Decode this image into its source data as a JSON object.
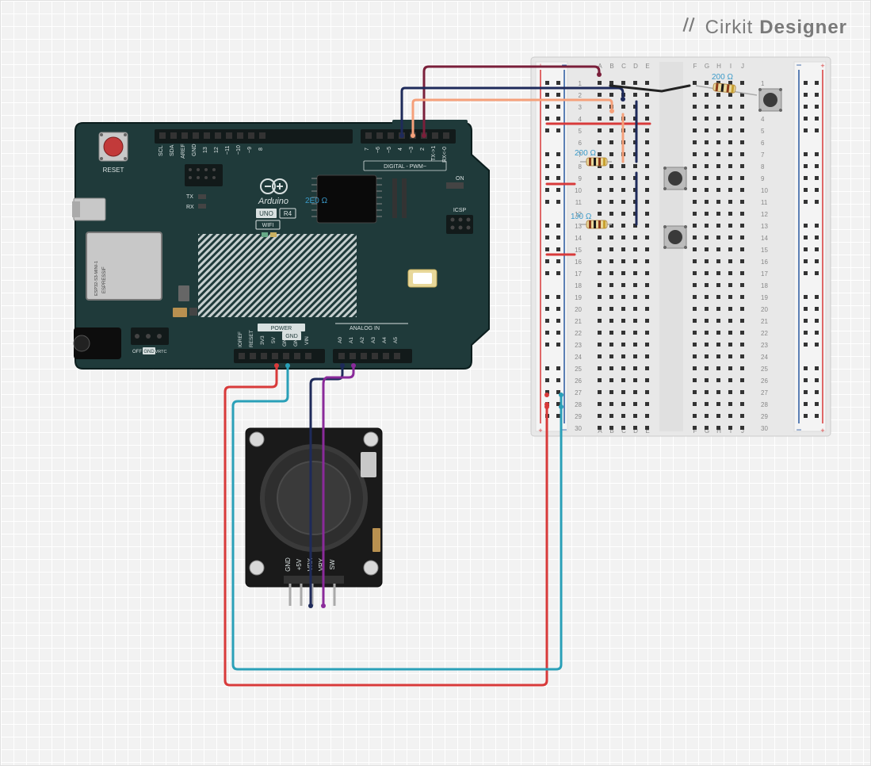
{
  "logo": {
    "brand1": "Cirkit",
    "brand2": "Designer"
  },
  "arduino": {
    "board_line1": "UNO",
    "board_line2": "R4",
    "board_line3": "WIFI",
    "espressif": "ESPRESSIF",
    "esp32_label": "ESP32-S3-MINI-1",
    "reset": "RESET",
    "digital_header": "DIGITAL - PWM~",
    "analog_header": "ANALOG  IN",
    "power_header": "POWER",
    "icsp": "ICSP",
    "tx": "TX",
    "rx": "RX",
    "on": "ON",
    "off": "OFF",
    "gnd_barrel": "GND",
    "vrtc": "VRTC",
    "pins_top": [
      "SCL",
      "SDA",
      "AREF",
      "GND",
      "13",
      "12",
      "~11",
      "~10",
      "~9",
      "8",
      "7",
      "~6",
      "~5",
      "4",
      "~3",
      "2",
      "TX->1",
      "RX<-0"
    ],
    "pins_bottom": [
      "IOREF",
      "RESET",
      "3V3",
      "5V",
      "GND",
      "GND",
      "VIN",
      "A0",
      "A1",
      "A2",
      "A3",
      "A4",
      "A5"
    ]
  },
  "joystick": {
    "pins": [
      "GND",
      "+5V",
      "VRX",
      "VRY",
      "SW"
    ]
  },
  "breadboard": {
    "cols_left": [
      "A",
      "B",
      "C",
      "D",
      "E"
    ],
    "cols_right": [
      "F",
      "G",
      "H",
      "I",
      "J"
    ],
    "rows": 30
  },
  "resistors": [
    {
      "label": "200 Ω",
      "color": "#3a9ac9"
    },
    {
      "label": "200 Ω",
      "color": "#3a9ac9"
    },
    {
      "label": "2E0 Ω",
      "color": "#3a9ac9"
    },
    {
      "label": "1J0 Ω",
      "color": "#3a9ac9"
    }
  ],
  "wires": [
    {
      "name": "d2-to-bb1",
      "color": "#7a1f3a",
      "interactable": true
    },
    {
      "name": "d3-to-bb3",
      "color": "#f5a07a",
      "interactable": true
    },
    {
      "name": "d4-to-bb4",
      "color": "#1e2a5a",
      "interactable": true
    },
    {
      "name": "5v-to-rail",
      "color": "#d83a3a",
      "interactable": true
    },
    {
      "name": "gnd-to-rail",
      "color": "#2aa0b8",
      "interactable": true
    },
    {
      "name": "a0-joy-vrx",
      "color": "#1e2a5a",
      "interactable": true
    },
    {
      "name": "a1-joy-vry",
      "color": "#8a2a9a",
      "interactable": true
    },
    {
      "name": "joy-5v",
      "color": "#d83a3a",
      "interactable": true
    },
    {
      "name": "joy-gnd",
      "color": "#2aa0b8",
      "interactable": true
    },
    {
      "name": "bb-jumper-black",
      "color": "#222",
      "interactable": true
    },
    {
      "name": "bb-jumper-red-5",
      "color": "#d83a3a",
      "interactable": true
    },
    {
      "name": "bb-jumper-red-10",
      "color": "#d83a3a",
      "interactable": true
    },
    {
      "name": "bb-jumper-red-16",
      "color": "#d83a3a",
      "interactable": true
    },
    {
      "name": "bb-navy-8",
      "color": "#1e2a5a",
      "interactable": true
    },
    {
      "name": "bb-navy-13",
      "color": "#1e2a5a",
      "interactable": true
    },
    {
      "name": "bb-salmon-8",
      "color": "#f5a07a",
      "interactable": true
    }
  ]
}
